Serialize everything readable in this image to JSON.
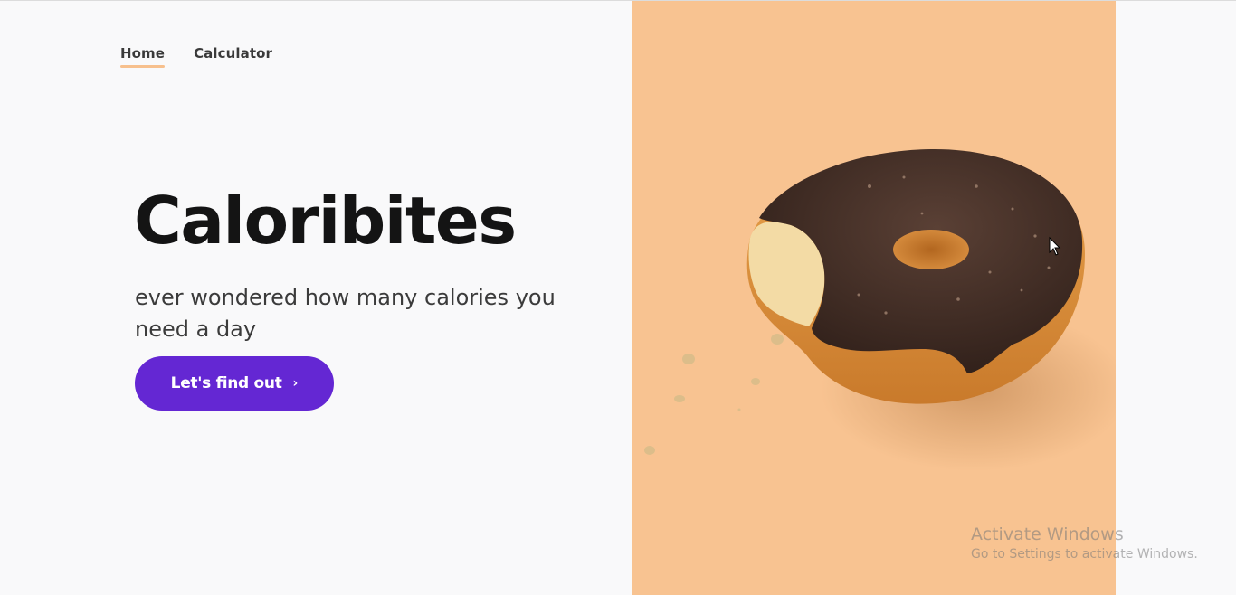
{
  "nav": {
    "items": [
      {
        "label": "Home",
        "active": true
      },
      {
        "label": "Calculator",
        "active": false
      }
    ]
  },
  "hero": {
    "title": "Caloribites",
    "subtitle": "ever wondered how many calories you need a day",
    "cta_label": "Let's find out",
    "cta_icon": "chevron-right-icon"
  },
  "image": {
    "subject": "donut-image",
    "background_color": "#f8c391"
  },
  "watermark": {
    "title": "Activate Windows",
    "subtitle": "Go to Settings to activate Windows."
  },
  "colors": {
    "accent": "#6427d3",
    "nav_underline": "#f7c08d",
    "title": "#141414"
  }
}
